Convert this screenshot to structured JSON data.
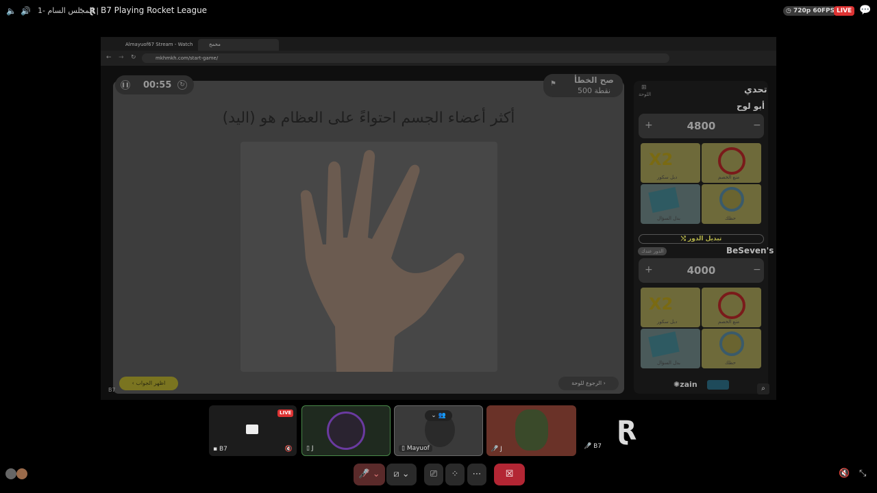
{
  "topbar": {
    "server_name": "المجلس السام -1 |",
    "stream_title": "B7 Playing Rocket League",
    "quality": "720p 60FPS",
    "live": "LIVE"
  },
  "browser": {
    "tab1_label": "Almayuof67 Stream - Watch Li...",
    "tab2_label": "مخمخ",
    "url": "mkhmkh.com/start-game/"
  },
  "game": {
    "timer": "00:55",
    "score_title": "صح الخطأ",
    "score_points": "500 نقطة",
    "question": "أكثر أعضاء الجسم احتواءً على العظام هو (اليد)",
    "show_answer": "اظهر الجواب",
    "back_to_board": "الرجوع للوحة"
  },
  "sidebar": {
    "title": "تحدي",
    "board_label": "اللوحة",
    "team1": {
      "name": "أبو لوح",
      "score": "4800"
    },
    "team2": {
      "name": "BeSeven's",
      "score": "4000",
      "turn_badge": "الدور عندك"
    },
    "swap_turn": "⤭ تبديل الدور",
    "cards": {
      "double": "X2",
      "double_label": "دبل سكور",
      "block_label": "منع الخصم",
      "swap_label": "بدل السؤال",
      "wheel_label": "حظك"
    },
    "sponsor": "zain"
  },
  "participants": [
    {
      "label": "B7",
      "live": "LIVE"
    },
    {
      "label": "J"
    },
    {
      "label": "Mayuof"
    },
    {
      "label": "J"
    },
    {
      "label": "B7"
    }
  ]
}
